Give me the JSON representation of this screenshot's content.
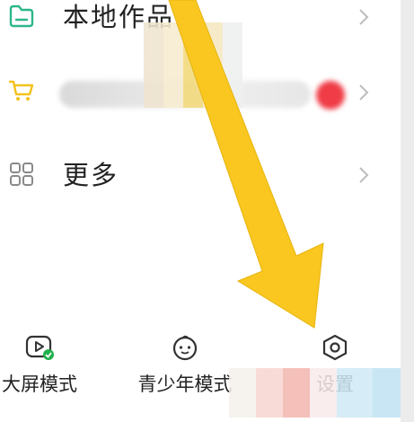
{
  "menu": {
    "items": [
      {
        "label": "本地作品",
        "icon": "folder-icon"
      },
      {
        "label": "",
        "icon": "cart-icon",
        "blurred": true
      },
      {
        "label": "更多",
        "icon": "grid-icon"
      }
    ]
  },
  "bottom_bar": {
    "items": [
      {
        "label": "大屏模式",
        "icon": "tv-play-check-icon"
      },
      {
        "label": "青少年模式",
        "icon": "child-face-icon"
      },
      {
        "label": "设置",
        "icon": "settings-hex-icon"
      }
    ]
  },
  "colors": {
    "folder": "#2db68c",
    "cart": "#f4c21b",
    "arrow": "#f9c71f",
    "badge": "#ef3c46",
    "check": "#21b04b"
  }
}
